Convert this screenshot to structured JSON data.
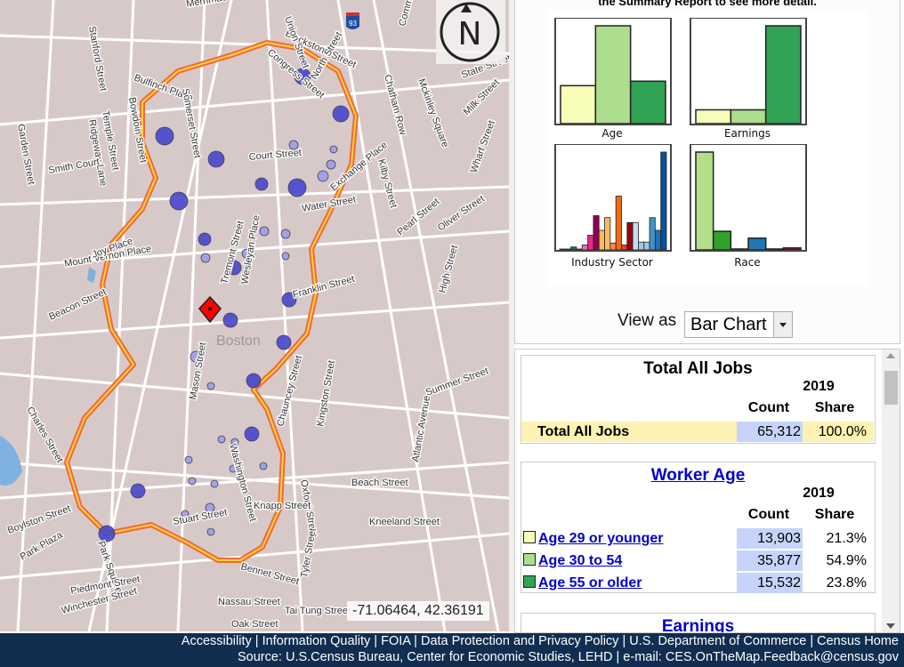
{
  "map": {
    "place_label": "Boston",
    "coordinates": "-71.06464, 42.36191",
    "compass_letter": "N",
    "highway_shield": "93",
    "street_labels": [
      "Merrimac Street",
      "Blackstone Street",
      "Union Street",
      "Congress Street",
      "North Street",
      "Bulfinch Place",
      "Somerset Street",
      "Bowdoin Street",
      "Temple Street",
      "Ridgeway Lane",
      "Smith Court",
      "Court Street",
      "Exchange Place",
      "Water Street",
      "Chatham Row",
      "Mckinley Square",
      "Kilby Street",
      "State Street",
      "Milk Street",
      "Pearl Street",
      "Oliver Street",
      "Wharf Street",
      "Mount Vernon Place",
      "Joy Place",
      "Beacon Street",
      "Tremont Street",
      "Wesleyan Place",
      "Franklin Street",
      "High Street",
      "Mason Street",
      "Washington Street",
      "Chauncey Street",
      "Kingston Street",
      "Summer Street",
      "Charles Street",
      "Oxford Street",
      "Atlantic Avenue",
      "Beach Street",
      "Boylston Street",
      "Knapp Street",
      "Stuart Street",
      "Kneeland Street",
      "Park Plaza",
      "Park Square",
      "Bennet Street",
      "Tyler Street",
      "Piedmont Street",
      "Winchester Street",
      "Nassau Street",
      "Tai Tung Street",
      "Oak Street",
      "Commercial",
      "Garden Street",
      "Stanford Street"
    ],
    "colors": {
      "background": "#d8c9c9",
      "boundary": "#f2a118",
      "dots": "#5c5cd6",
      "marker": "#ff0000"
    }
  },
  "summary": {
    "note": "the Summary Report to see more detail.",
    "view_as_label": "View as",
    "view_as_value": "Bar Chart"
  },
  "chart_data": [
    {
      "type": "bar",
      "title": "Age",
      "values": [
        21.3,
        54.9,
        23.8
      ],
      "colors": [
        "#f7fcb9",
        "#addd8e",
        "#31a354"
      ]
    },
    {
      "type": "bar",
      "title": "Earnings",
      "values": [
        11,
        11,
        78
      ],
      "colors": [
        "#f7fcb9",
        "#addd8e",
        "#31a354"
      ]
    },
    {
      "type": "bar",
      "title": "Industry Sector",
      "values": [
        0.3,
        0.3,
        3,
        0.3,
        5,
        15,
        35,
        20,
        33,
        7,
        55,
        5,
        28,
        28,
        8,
        8,
        33,
        20,
        100
      ],
      "colors": [
        "#1b7837",
        "#1b7837",
        "#1b7837",
        "#c51b7d",
        "#de77ae",
        "#e7298a",
        "#8e0152",
        "#fdb863",
        "#fdb863",
        "#fd8d3c",
        "#f16913",
        "#ef3b2c",
        "#99000d",
        "#c6dbef",
        "#9ecae1",
        "#9ecae1",
        "#4292c6",
        "#2171b5",
        "#08519c"
      ]
    },
    {
      "type": "bar",
      "title": "Race",
      "values": [
        100,
        19,
        0.5,
        12,
        0.5,
        2
      ],
      "colors": [
        "#b2df8a",
        "#33a02c",
        "#333333",
        "#1f78b4",
        "#333333",
        "#b2182b"
      ]
    }
  ],
  "report": {
    "total": {
      "title": "Total All Jobs",
      "year": "2019",
      "count_header": "Count",
      "share_header": "Share",
      "label": "Total All Jobs",
      "count": "65,312",
      "share": "100.0%"
    },
    "age": {
      "title": "Worker Age",
      "year": "2019",
      "count_header": "Count",
      "share_header": "Share",
      "rows": [
        {
          "label": "Age 29 or younger",
          "count": "13,903",
          "share": "21.3%",
          "color": "#f7fcb9"
        },
        {
          "label": "Age 30 to 54",
          "count": "35,877",
          "share": "54.9%",
          "color": "#addd8e"
        },
        {
          "label": "Age 55 or older",
          "count": "15,532",
          "share": "23.8%",
          "color": "#31a354"
        }
      ]
    },
    "earnings_title": "Earnings"
  },
  "footer": {
    "links": [
      "Accessibility",
      "Information Quality",
      "FOIA",
      "Data Protection and Privacy Policy",
      "U.S. Department of Commerce",
      "Census Home"
    ],
    "source": "Source: U.S.Census Bureau, Center for Economic Studies, LEHD | e-mail: CES.OnTheMap.Feedback@census.gov"
  }
}
